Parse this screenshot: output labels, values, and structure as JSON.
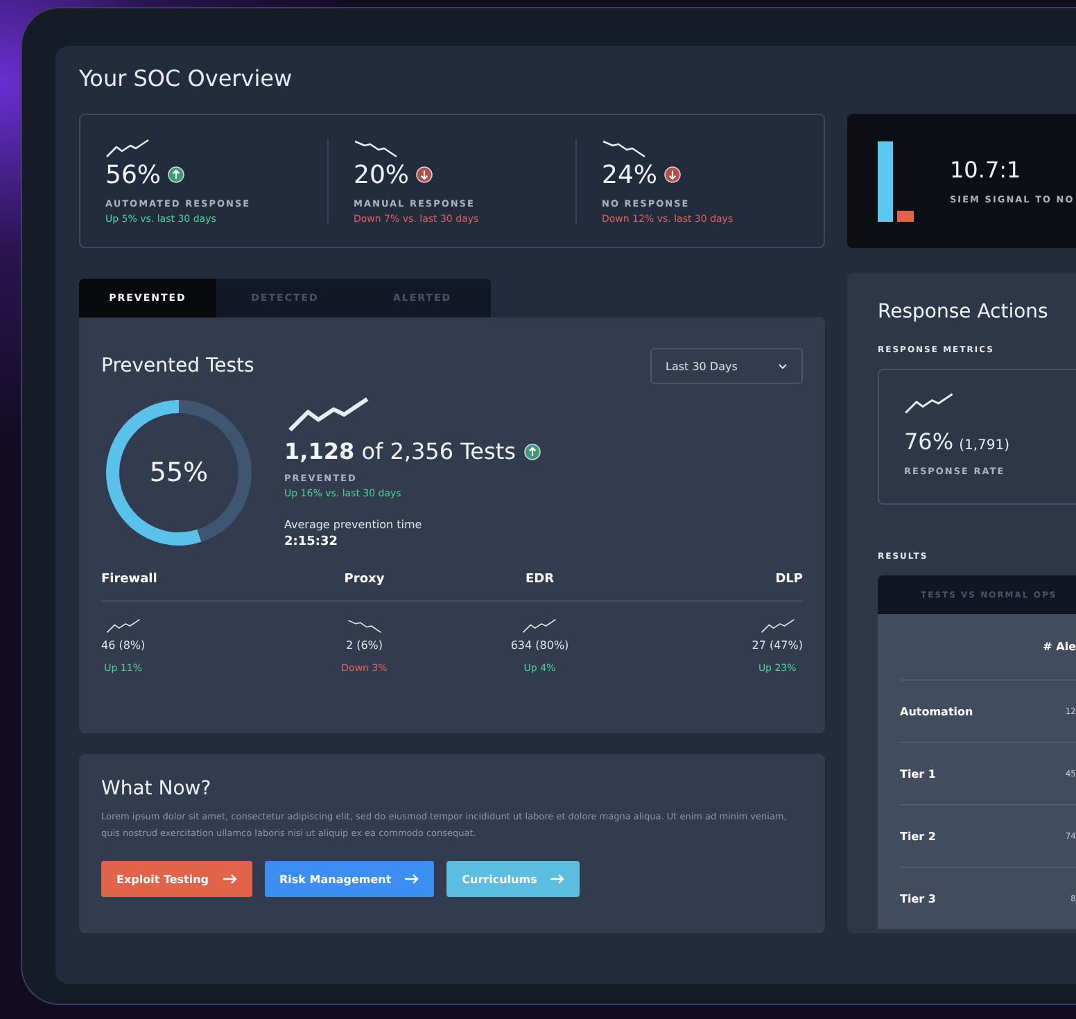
{
  "title": "Your SOC Overview",
  "kpis": [
    {
      "value": "56%",
      "rising": true,
      "label": "AUTOMATED RESPONSE",
      "change": "Up 5% vs. last 30 days"
    },
    {
      "value": "20%",
      "rising": false,
      "label": "MANUAL RESPONSE",
      "change": "Down 7% vs. last 30 days"
    },
    {
      "value": "24%",
      "rising": false,
      "label": "NO RESPONSE",
      "change": "Down 12% vs. last 30 days"
    }
  ],
  "siem": {
    "value": "10.7:1",
    "label": "SIEM SIGNAL TO NO"
  },
  "tabs": [
    {
      "label": "PREVENTED",
      "selected": true
    },
    {
      "label": "DETECTED",
      "selected": false
    },
    {
      "label": "ALERTED",
      "selected": false
    }
  ],
  "prevented": {
    "title": "Prevented Tests",
    "range": "Last 30 Days",
    "percent": "55%",
    "chart_data": {
      "type": "donut",
      "values": [
        55,
        45
      ]
    },
    "count": "1,128",
    "of": "of 2,356 Tests",
    "rising": true,
    "label": "PREVENTED",
    "change": "Up 16% vs. last 30 days",
    "avg_label": "Average prevention time",
    "avg_value": "2:15:32",
    "categories": [
      {
        "name": "Firewall",
        "value": "46 (8%)",
        "rising": true,
        "change": "Up 11%"
      },
      {
        "name": "Proxy",
        "value": "2 (6%)",
        "rising": false,
        "change": "Down 3%"
      },
      {
        "name": "EDR",
        "value": "634 (80%)",
        "rising": true,
        "change": "Up 4%"
      },
      {
        "name": "DLP",
        "value": "27 (47%)",
        "rising": true,
        "change": "Up 23%"
      }
    ]
  },
  "what_now": {
    "title": "What Now?",
    "text": "Lorem ipsum dolor sit amet, consectetur adipiscing elit, sed do eiusmod tempor incididunt ut labore et dolore magna aliqua. Ut enim ad minim veniam, quis nostrud exercitation ullamco laboris nisi ut aliquip ex ea commodo consequat.",
    "buttons": [
      {
        "label": "Exploit Testing",
        "color": "#e0634a"
      },
      {
        "label": "Risk Management",
        "color": "#3d8ef2"
      },
      {
        "label": "Curriculums",
        "color": "#5bbde0"
      }
    ]
  },
  "response": {
    "title": "Response Actions",
    "metrics_label": "RESPONSE METRICS",
    "metric_value": "76%",
    "metric_count": "(1,791)",
    "metric_label": "RESPONSE RATE",
    "results_label": "RESULTS",
    "results_tab": "TESTS VS NORMAL OPS",
    "column": "# Ale",
    "rows": [
      {
        "name": "Automation",
        "value": "12"
      },
      {
        "name": "Tier 1",
        "value": "45"
      },
      {
        "name": "Tier 2",
        "value": "74"
      },
      {
        "name": "Tier 3",
        "value": "8"
      }
    ]
  }
}
